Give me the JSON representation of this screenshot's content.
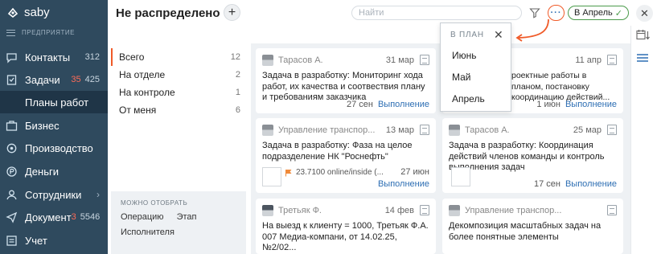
{
  "app": {
    "logo_text": "saby",
    "section_label": "ПРЕДПРИЯТИЕ"
  },
  "sidebar": {
    "items": [
      {
        "label": "Контакты",
        "count": "312",
        "icon": "contacts-icon"
      },
      {
        "label": "Задачи",
        "count_red": "35",
        "count": "425",
        "icon": "tasks-icon"
      },
      {
        "label": "Планы работ",
        "sub": true
      },
      {
        "label": "Бизнес",
        "icon": "business-icon"
      },
      {
        "label": "Производство",
        "icon": "production-icon"
      },
      {
        "label": "Деньги",
        "icon": "money-icon"
      },
      {
        "label": "Сотрудники",
        "icon": "employees-icon"
      },
      {
        "label": "Документ",
        "count_red": "3",
        "count": "5546",
        "icon": "documents-icon"
      },
      {
        "label": "Учет",
        "icon": "accounting-icon"
      }
    ]
  },
  "header": {
    "title": "Не распределено",
    "search_placeholder": "Найти",
    "period_label": "В Апрель",
    "more_label": "···"
  },
  "filters": {
    "items": [
      {
        "label": "Всего",
        "count": "12"
      },
      {
        "label": "На отделе",
        "count": "2"
      },
      {
        "label": "На контроле",
        "count": "1"
      },
      {
        "label": "От меня",
        "count": "6"
      }
    ],
    "can_select_title": "МОЖНО ОТОБРАТЬ",
    "links": [
      "Операцию",
      "Этап",
      "Исполнителя"
    ]
  },
  "popup": {
    "title": "В ПЛАН",
    "items": [
      "Июнь",
      "Май",
      "Апрель"
    ]
  },
  "cards": [
    {
      "author": "Тарасов А.",
      "date": "31 мар",
      "text": "Задача в разработку: Мониторинг хода работ, их качества и соотвествия плану и требованиям заказчика",
      "foot_date": "27 сен",
      "status": "Выполнение"
    },
    {
      "author": "",
      "date": "11 апр",
      "text_lines": [
        "роектные работы в",
        "планом, постановку",
        "координацию действий..."
      ],
      "foot_date": "1 июн",
      "status": "Выполнение"
    },
    {
      "author": "Управление транспор...",
      "date": "13 мар",
      "text": "Задача в разработку: Фаза на целое подразделение НК \"Роснефть\"",
      "flag_text": "23.7100 online/inside (...",
      "foot_date": "27 июн",
      "status": "Выполнение"
    },
    {
      "author": "Тарасов А.",
      "date": "25 мар",
      "text": "Задача в разработку: Координация действий членов команды и контроль выполнения задач",
      "foot_date": "17 сен",
      "status": "Выполнение"
    },
    {
      "author": "Третьяк Ф.",
      "date": "14 фев",
      "text": "На выезд к клиенту = 1000, Третьяк Ф.А. 007 Медиа-компани, от 14.02.25, №2/02..."
    },
    {
      "author": "Управление транспор...",
      "date": "",
      "text": "Декомпозиция масштабных задач на более понятные элементы"
    }
  ],
  "colors": {
    "sidebar_bg": "#2f4a5e",
    "accent_orange": "#f05a28",
    "link_blue": "#2d6eb3",
    "period_green": "#4b9b4b"
  }
}
